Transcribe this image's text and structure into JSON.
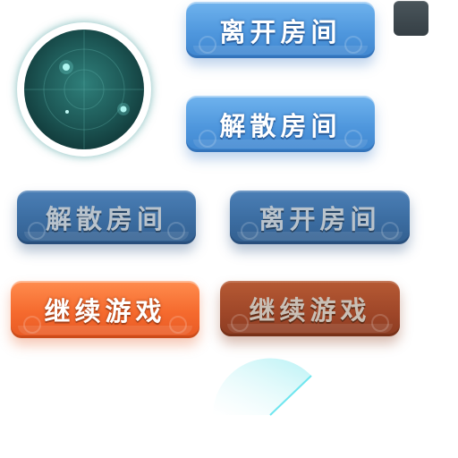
{
  "buttons": {
    "leave_room_active": "离开房间",
    "dissolve_room_active": "解散房间",
    "dissolve_room_disabled": "解散房间",
    "leave_room_disabled": "离开房间",
    "continue_game_active": "继续游戏",
    "continue_game_disabled": "继续游戏"
  },
  "colors": {
    "blue_button": "#4f97dd",
    "blue_button_disabled": "#3a6b9f",
    "orange_button": "#f56a2e",
    "orange_button_disabled": "#9e4628",
    "radar_screen": "#1e5a58",
    "close_square": "#3c474d"
  },
  "icons": {
    "radar": "radar-icon",
    "close_square": "square-button-icon",
    "sweep": "radar-sweep-icon"
  }
}
